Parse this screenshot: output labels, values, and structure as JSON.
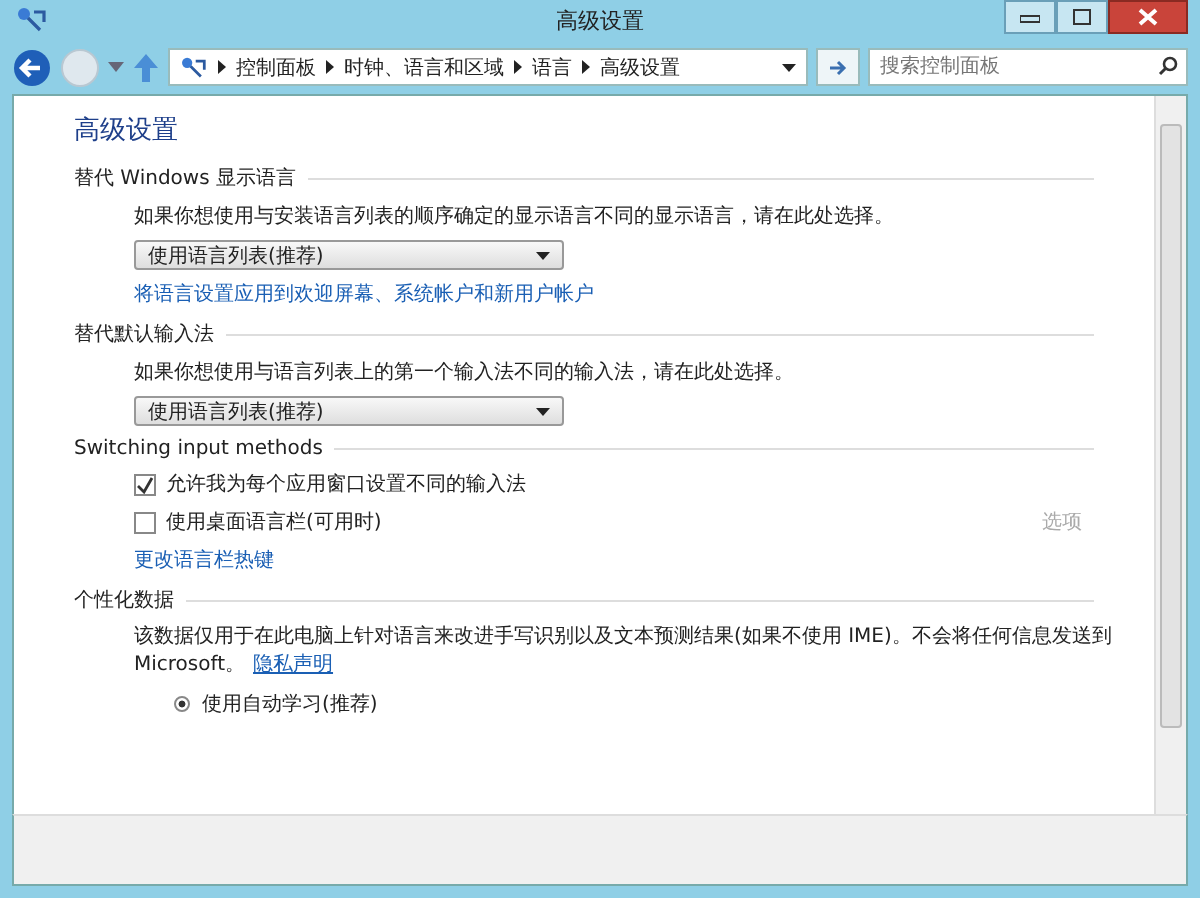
{
  "window": {
    "title": "高级设置"
  },
  "nav": {
    "breadcrumb": [
      "控制面板",
      "时钟、语言和区域",
      "语言",
      "高级设置"
    ],
    "search": {
      "placeholder": "搜索控制面板"
    }
  },
  "heading": "高级设置",
  "sections": [
    {
      "kind": "dropdown",
      "title": "替代 Windows 显示语言",
      "description": "如果你想使用与安装语言列表的顺序确定的显示语言不同的显示语言，请在此处选择。",
      "value": "使用语言列表(推荐)",
      "link": "将语言设置应用到欢迎屏幕、系统帐户和新用户帐户"
    },
    {
      "kind": "dropdown",
      "title": "替代默认输入法",
      "description": "如果你想使用与语言列表上的第一个输入法不同的输入法，请在此处选择。",
      "value": "使用语言列表(推荐)"
    },
    {
      "kind": "checks",
      "title": "Switching input methods",
      "options": [
        {
          "label": "允许我为每个应用窗口设置不同的输入法",
          "checked": true
        },
        {
          "label": "使用桌面语言栏(可用时)",
          "checked": false,
          "action": {
            "label": "选项",
            "disabled": true
          }
        }
      ],
      "link": "更改语言栏热键"
    },
    {
      "kind": "radios",
      "title": "个性化数据",
      "description": "该数据仅用于在此电脑上针对语言来改进手写识别以及文本预测结果(如果不使用 IME)。不会将任何信息发送到 Microsoft。",
      "link": "隐私声明",
      "options": [
        {
          "label": "使用自动学习(推荐)",
          "selected": true
        }
      ]
    }
  ]
}
